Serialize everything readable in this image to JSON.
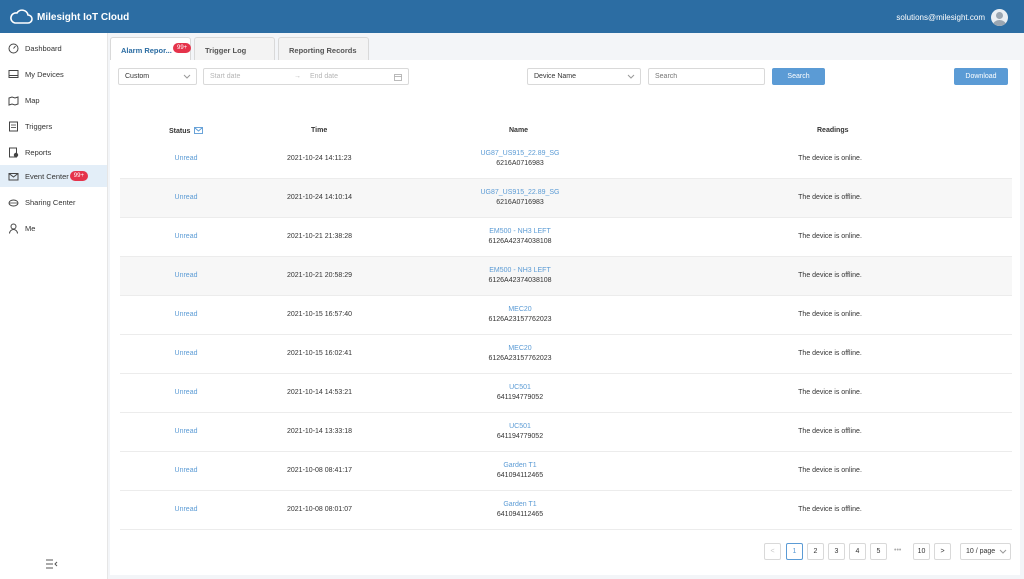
{
  "app": {
    "title": "Milesight IoT Cloud",
    "user_email": "solutions@milesight.com"
  },
  "sidebar": {
    "items": [
      {
        "label": "Dashboard",
        "icon": "dashboard-icon"
      },
      {
        "label": "My Devices",
        "icon": "devices-icon"
      },
      {
        "label": "Map",
        "icon": "map-icon"
      },
      {
        "label": "Triggers",
        "icon": "triggers-icon"
      },
      {
        "label": "Reports",
        "icon": "reports-icon"
      },
      {
        "label": "Event Center",
        "icon": "mail-icon",
        "badge": "99+",
        "active": true
      },
      {
        "label": "Sharing Center",
        "icon": "sharing-icon"
      },
      {
        "label": "Me",
        "icon": "user-icon"
      }
    ]
  },
  "tabs": [
    {
      "label": "Alarm Repor...",
      "badge": "99+",
      "active": true
    },
    {
      "label": "Trigger Log"
    },
    {
      "label": "Reporting Records"
    }
  ],
  "filters": {
    "range_select": "Custom",
    "start_placeholder": "Start date",
    "end_placeholder": "End date",
    "field_select": "Device Name",
    "search_placeholder": "Search",
    "search_button": "Search",
    "download_button": "Download"
  },
  "table": {
    "headers": {
      "status": "Status",
      "time": "Time",
      "name": "Name",
      "readings": "Readings"
    },
    "rows": [
      {
        "status": "Unread",
        "time": "2021-10-24 14:11:23",
        "device": "UG87_US915_22.89_SG",
        "sn": "6216A0716983",
        "reading": "The device is online."
      },
      {
        "status": "Unread",
        "time": "2021-10-24 14:10:14",
        "device": "UG87_US915_22.89_SG",
        "sn": "6216A0716983",
        "reading": "The device is offline."
      },
      {
        "status": "Unread",
        "time": "2021-10-21 21:38:28",
        "device": "EM500 - NH3 LEFT",
        "sn": "6126A42374038108",
        "reading": "The device is online."
      },
      {
        "status": "Unread",
        "time": "2021-10-21 20:58:29",
        "device": "EM500 - NH3 LEFT",
        "sn": "6126A42374038108",
        "reading": "The device is offline."
      },
      {
        "status": "Unread",
        "time": "2021-10-15 16:57:40",
        "device": "MEC20",
        "sn": "6126A23157762023",
        "reading": "The device is online."
      },
      {
        "status": "Unread",
        "time": "2021-10-15 16:02:41",
        "device": "MEC20",
        "sn": "6126A23157762023",
        "reading": "The device is offline."
      },
      {
        "status": "Unread",
        "time": "2021-10-14 14:53:21",
        "device": "UC501",
        "sn": "641194779052",
        "reading": "The device is online."
      },
      {
        "status": "Unread",
        "time": "2021-10-14 13:33:18",
        "device": "UC501",
        "sn": "641194779052",
        "reading": "The device is offline."
      },
      {
        "status": "Unread",
        "time": "2021-10-08 08:41:17",
        "device": "Garden T1",
        "sn": "641094112465",
        "reading": "The device is online."
      },
      {
        "status": "Unread",
        "time": "2021-10-08 08:01:07",
        "device": "Garden T1",
        "sn": "641094112465",
        "reading": "The device is offline."
      }
    ]
  },
  "pagination": {
    "prev": "<",
    "pages": [
      "1",
      "2",
      "3",
      "4",
      "5"
    ],
    "ellipsis": "•••",
    "last": "10",
    "next": ">",
    "page_size": "10 / page",
    "current": "1"
  },
  "colors": {
    "header": "#2c6da3",
    "accent": "#5b9bd5",
    "badge": "#e5334b"
  }
}
